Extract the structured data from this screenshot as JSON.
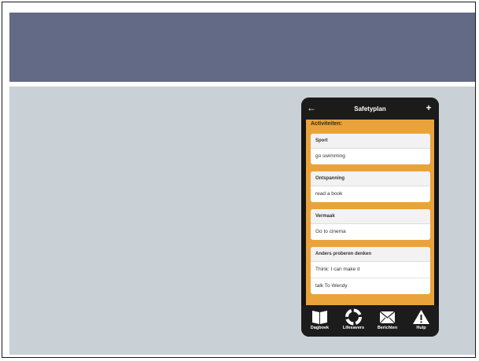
{
  "app": {
    "nav": {
      "title": "Safetyplan",
      "back_glyph": "←",
      "add_glyph": "+"
    },
    "section_heading": "Activiteiten:",
    "cards": [
      {
        "header": "Sport",
        "items": [
          "go swimming"
        ]
      },
      {
        "header": "Ontspanning",
        "items": [
          "read a book"
        ]
      },
      {
        "header": "Vermaak",
        "items": [
          "Go to cinema"
        ]
      },
      {
        "header": "Anders proberen denken",
        "items": [
          "Think: I can make it",
          "talk To Wendy"
        ]
      }
    ],
    "tabs": [
      {
        "label": "Dagboek",
        "icon": "book-icon"
      },
      {
        "label": "Lifesavers",
        "icon": "lifebuoy-icon"
      },
      {
        "label": "Berichten",
        "icon": "envelope-icon"
      },
      {
        "label": "Hulp",
        "icon": "warning-icon"
      }
    ]
  },
  "colors": {
    "title_band": "#636a86",
    "content_band": "#c9d1d6",
    "accent_orange": "#eaa33a",
    "phone_bezel": "#141414"
  }
}
